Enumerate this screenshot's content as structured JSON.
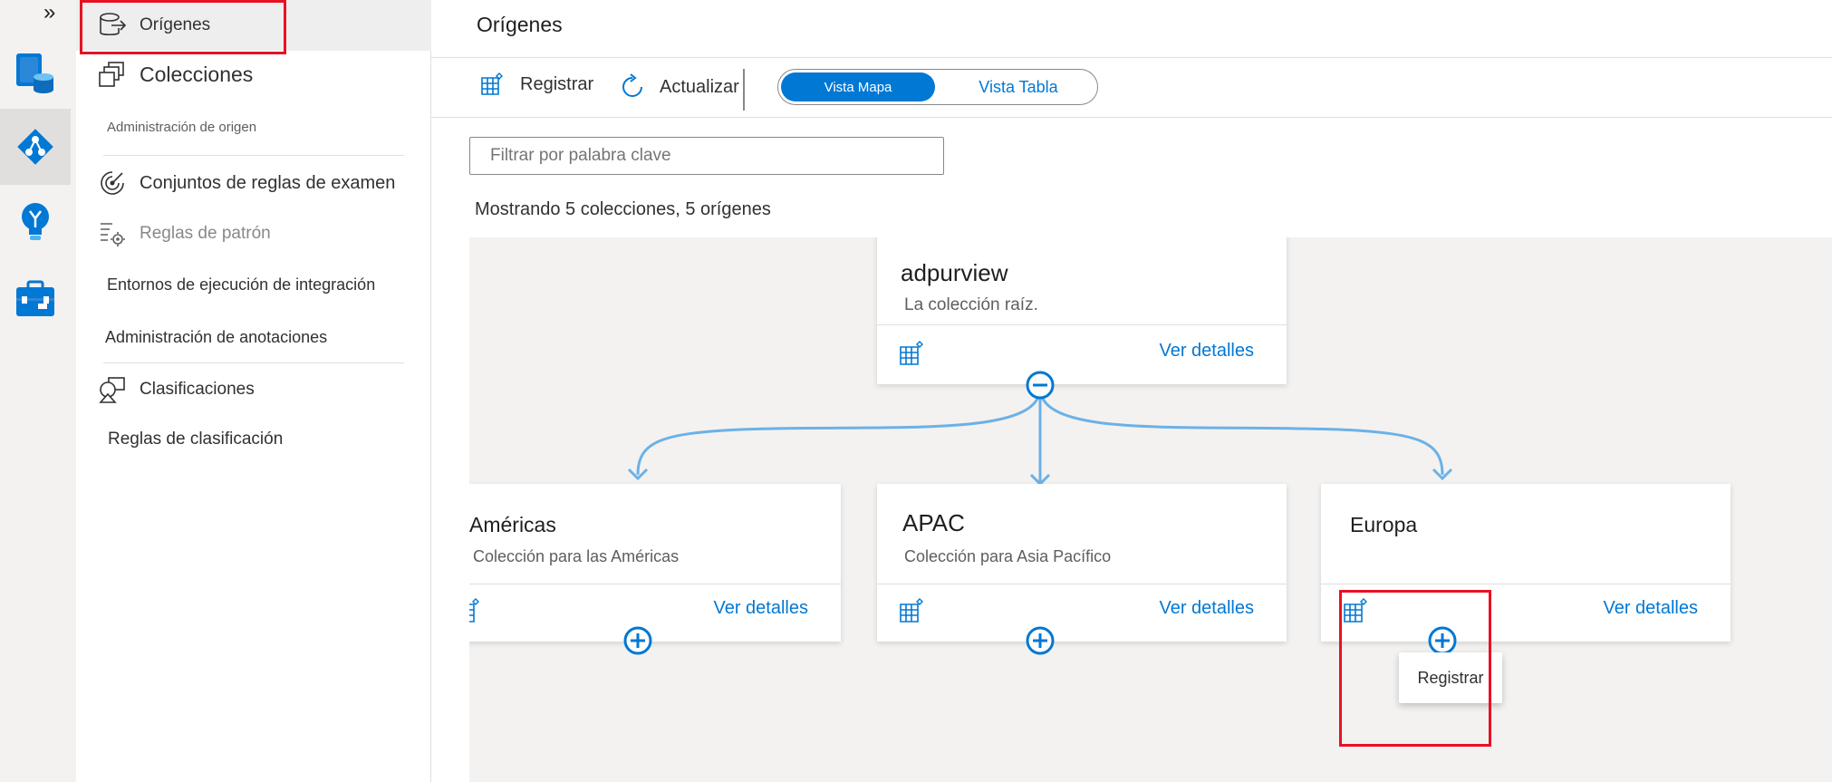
{
  "rail": {
    "collapse_glyph": "»",
    "icons": [
      "data-map-icon",
      "sources-diamond-icon",
      "insights-bulb-icon",
      "management-toolbox-icon"
    ]
  },
  "nav": {
    "sources": "Orígenes",
    "collections": "Colecciones",
    "section_header": "Administración de origen",
    "scan_rule_sets": "Conjuntos de reglas de examen",
    "pattern_rules": "Reglas de patrón",
    "integration_runtimes": "Entornos de ejecución de integración",
    "annotation_management": "Administración de anotaciones",
    "classifications": "Clasificaciones",
    "classification_rules": "Reglas de clasificación"
  },
  "main": {
    "title": "Orígenes",
    "register_label": "Registrar",
    "refresh_label": "Actualizar",
    "view_map": "Vista Mapa",
    "view_table": "Vista Tabla",
    "filter_placeholder": "Filtrar por palabra clave",
    "showing": "Mostrando 5 colecciones, 5 orígenes"
  },
  "cards": {
    "root": {
      "name": "adpurview",
      "desc": "La colección raíz.",
      "details": "Ver detalles"
    },
    "americas": {
      "name": "Américas",
      "desc": "Colección para las Américas",
      "details": "Ver detalles"
    },
    "apac": {
      "name": "APAC",
      "desc": "Colección para Asia Pacífico",
      "details": "Ver detalles"
    },
    "europe": {
      "name": "Europa",
      "desc": "",
      "details": "Ver detalles"
    }
  },
  "tooltip": {
    "register": "Registrar"
  },
  "colors": {
    "accent": "#0078d4",
    "connector": "#6cb1e6",
    "highlight": "#e81123",
    "canvas": "#f3f2f1"
  }
}
